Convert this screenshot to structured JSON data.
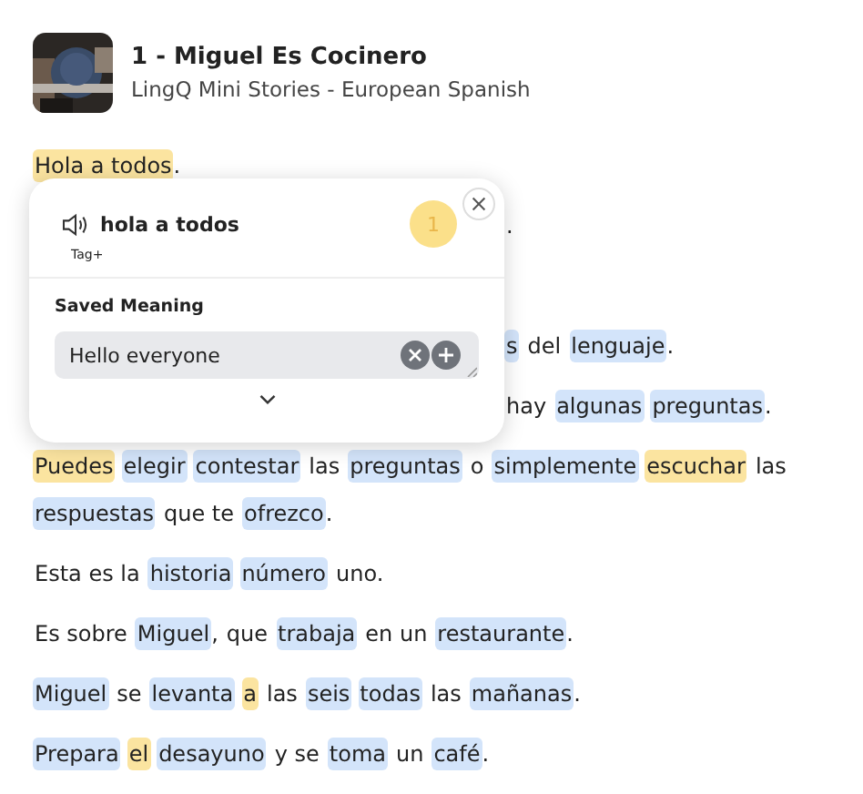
{
  "lesson": {
    "title": "1 - Miguel Es Cocinero",
    "course": "LingQ Mini Stories - European Spanish"
  },
  "paragraphs": [
    {
      "kind": "full",
      "tokens": [
        {
          "w": "Hola a todos",
          "kind": "lingq",
          "punct": "."
        }
      ]
    },
    {
      "kind": "partial",
      "tokens": [
        {
          "w": ".",
          "kind": "known"
        }
      ]
    },
    {
      "kind": "tail",
      "tokens": [
        {
          "w": "s",
          "kind": "new"
        },
        {
          "w": "del",
          "kind": "known"
        },
        {
          "w": "lenguaje",
          "kind": "new",
          "punct": "."
        }
      ]
    },
    {
      "kind": "partial",
      "tokens": [
        {
          "w": "hay",
          "kind": "known"
        },
        {
          "w": "algunas",
          "kind": "new"
        },
        {
          "w": "preguntas",
          "kind": "new",
          "punct": "."
        }
      ]
    },
    {
      "kind": "full",
      "tokens": [
        {
          "w": "Puedes",
          "kind": "lingq"
        },
        {
          "w": "elegir",
          "kind": "new"
        },
        {
          "w": "contestar",
          "kind": "new"
        },
        {
          "w": "las",
          "kind": "known"
        },
        {
          "w": "preguntas",
          "kind": "new"
        },
        {
          "w": "o",
          "kind": "known"
        },
        {
          "w": "simplemente",
          "kind": "new"
        },
        {
          "w": "escuchar",
          "kind": "lingq"
        },
        {
          "w": "las",
          "kind": "known"
        },
        {
          "w": "respuestas",
          "kind": "new"
        },
        {
          "w": "que te",
          "kind": "known"
        },
        {
          "w": "ofrezco",
          "kind": "new",
          "punct": "."
        }
      ]
    },
    {
      "kind": "full",
      "tokens": [
        {
          "w": "Esta es la",
          "kind": "known"
        },
        {
          "w": "historia",
          "kind": "new"
        },
        {
          "w": "número",
          "kind": "new"
        },
        {
          "w": "uno.",
          "kind": "known"
        }
      ]
    },
    {
      "kind": "full",
      "tokens": [
        {
          "w": "Es sobre",
          "kind": "known"
        },
        {
          "w": "Miguel",
          "kind": "new",
          "punct": ","
        },
        {
          "w": "que",
          "kind": "known"
        },
        {
          "w": "trabaja",
          "kind": "new"
        },
        {
          "w": "en un",
          "kind": "known"
        },
        {
          "w": "restaurante",
          "kind": "new",
          "punct": "."
        }
      ]
    },
    {
      "kind": "full",
      "tokens": [
        {
          "w": "Miguel",
          "kind": "new"
        },
        {
          "w": "se",
          "kind": "known"
        },
        {
          "w": "levanta",
          "kind": "new"
        },
        {
          "w": "a",
          "kind": "lingq"
        },
        {
          "w": "las",
          "kind": "known"
        },
        {
          "w": "seis",
          "kind": "new"
        },
        {
          "w": "todas",
          "kind": "new"
        },
        {
          "w": "las",
          "kind": "known"
        },
        {
          "w": "mañanas",
          "kind": "new",
          "punct": "."
        }
      ]
    },
    {
      "kind": "full",
      "tokens": [
        {
          "w": "Prepara",
          "kind": "new"
        },
        {
          "w": "el",
          "kind": "lingq"
        },
        {
          "w": "desayuno",
          "kind": "new"
        },
        {
          "w": "y se",
          "kind": "known"
        },
        {
          "w": "toma",
          "kind": "new"
        },
        {
          "w": "un",
          "kind": "known"
        },
        {
          "w": "café",
          "kind": "new",
          "punct": "."
        }
      ]
    }
  ],
  "popup": {
    "term": "hola a todos",
    "status_level": "1",
    "tag_label": "Tag+",
    "section_title": "Saved Meaning",
    "meaning": "Hello everyone"
  }
}
